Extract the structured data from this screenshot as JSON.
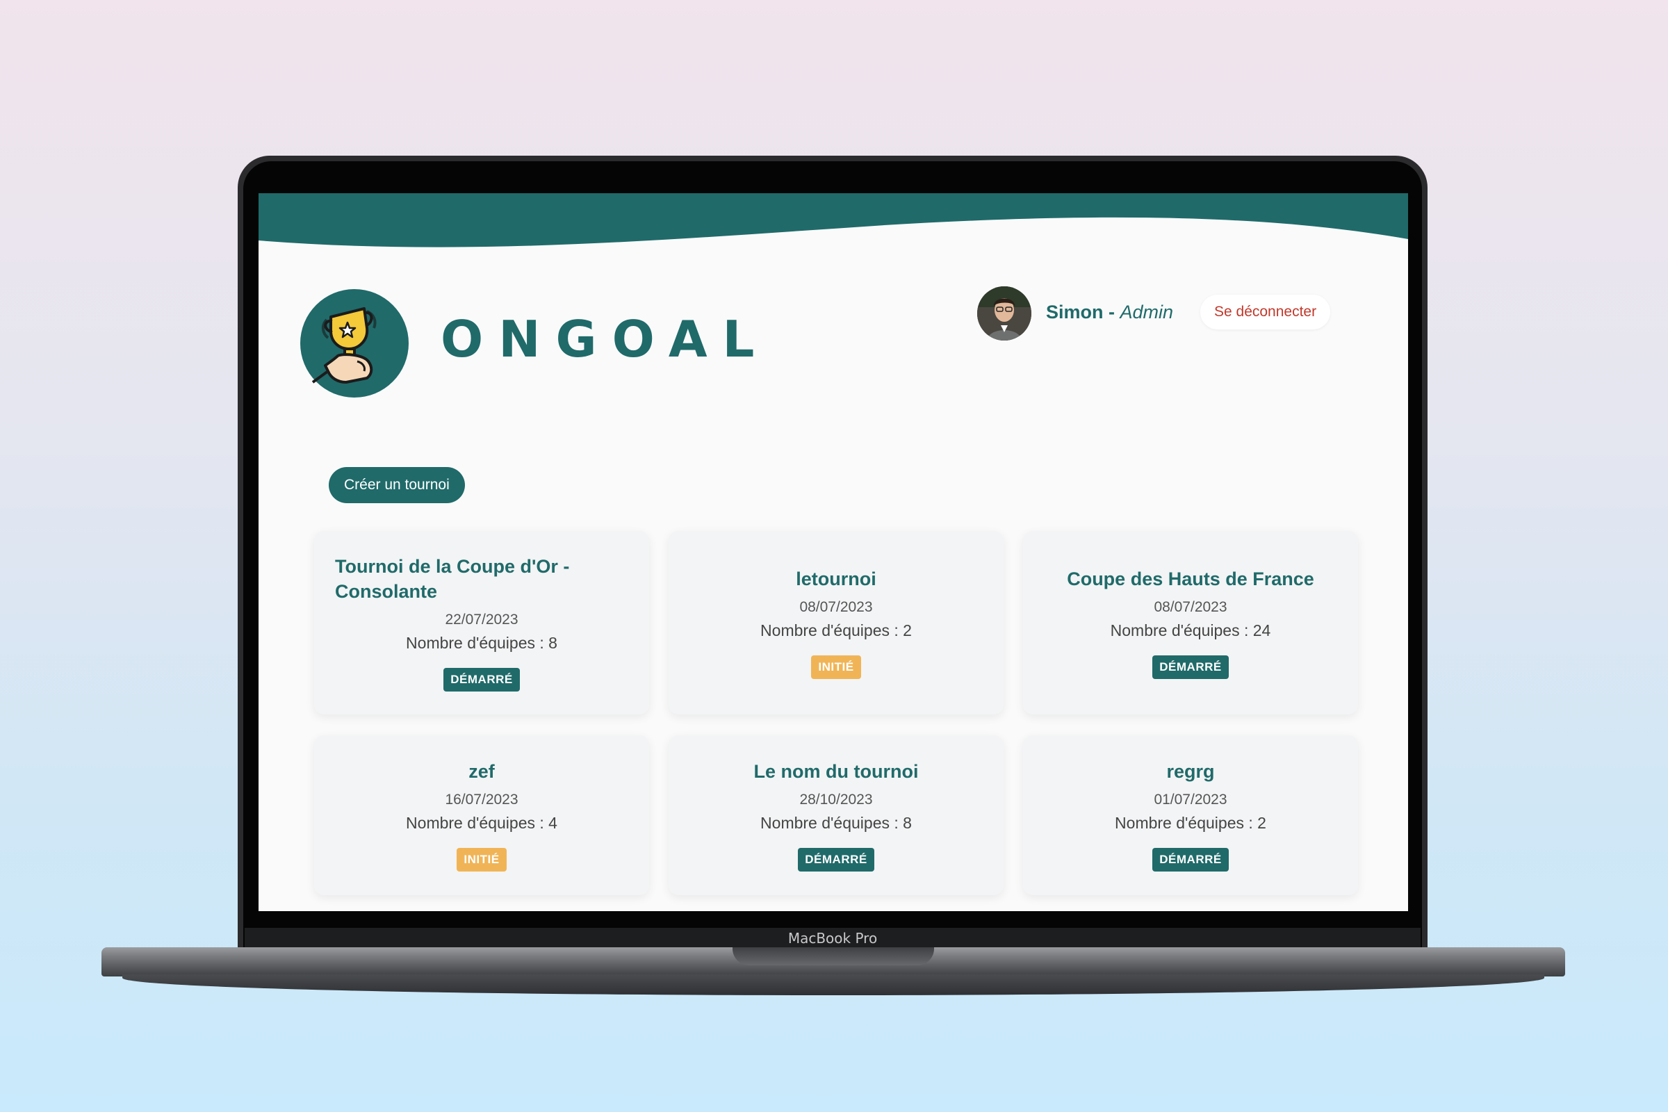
{
  "device_label": "MacBook Pro",
  "colors": {
    "primary": "#206a6a",
    "badge_started": "#206a6a",
    "badge_initiated": "#f0b456",
    "logout_text": "#c0392b"
  },
  "brand": {
    "name": "ONGOAL",
    "logo_icon": "trophy-in-hand-icon"
  },
  "user": {
    "name": "Simon",
    "separator": " - ",
    "role": "Admin",
    "logout_label": "Se déconnecter"
  },
  "actions": {
    "create_tournament_label": "Créer un tournoi"
  },
  "tournaments": [
    {
      "title": "Tournoi de la Coupe d'Or - Consolante",
      "date": "22/07/2023",
      "teams": "Nombre d'équipes : 8",
      "status": "DÉMARRÉ",
      "status_kind": "started"
    },
    {
      "title": "letournoi",
      "date": "08/07/2023",
      "teams": "Nombre d'équipes : 2",
      "status": "INITIÉ",
      "status_kind": "init"
    },
    {
      "title": "Coupe des Hauts de France",
      "date": "08/07/2023",
      "teams": "Nombre d'équipes : 24",
      "status": "DÉMARRÉ",
      "status_kind": "started"
    },
    {
      "title": "zef",
      "date": "16/07/2023",
      "teams": "Nombre d'équipes : 4",
      "status": "INITIÉ",
      "status_kind": "init"
    },
    {
      "title": "Le nom du tournoi",
      "date": "28/10/2023",
      "teams": "Nombre d'équipes : 8",
      "status": "DÉMARRÉ",
      "status_kind": "started"
    },
    {
      "title": "regrg",
      "date": "01/07/2023",
      "teams": "Nombre d'équipes : 2",
      "status": "DÉMARRÉ",
      "status_kind": "started"
    }
  ]
}
